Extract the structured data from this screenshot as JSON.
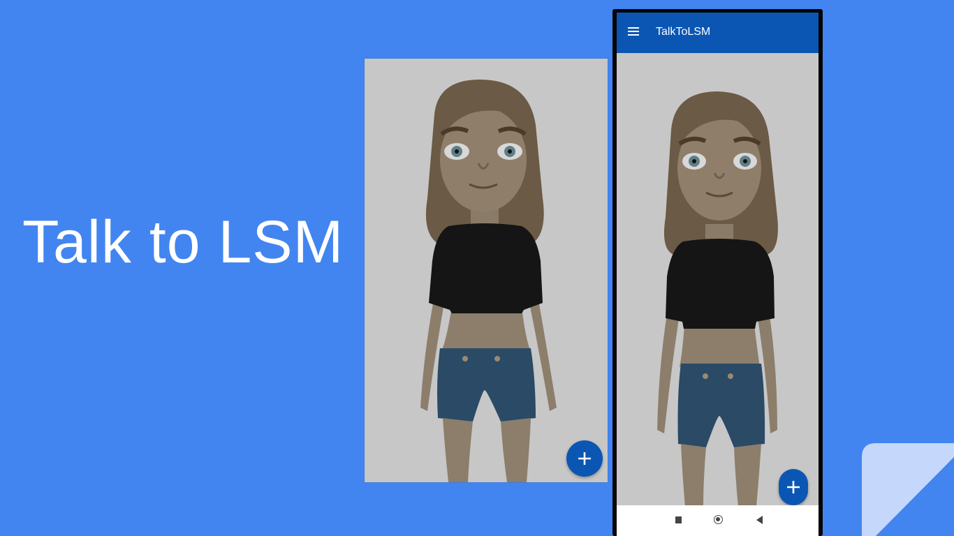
{
  "slide": {
    "title": "Talk to LSM"
  },
  "phone": {
    "app_title": "TalkToLSM",
    "icons": {
      "menu": "hamburger-menu-icon",
      "fab": "plus-icon",
      "nav_recents": "square-icon",
      "nav_home": "circle-icon",
      "nav_back": "triangle-back-icon"
    }
  },
  "colors": {
    "background": "#4285f0",
    "appbar": "#0b56b3",
    "fab": "#0b56b3",
    "canvas": "#c7c7c7"
  }
}
